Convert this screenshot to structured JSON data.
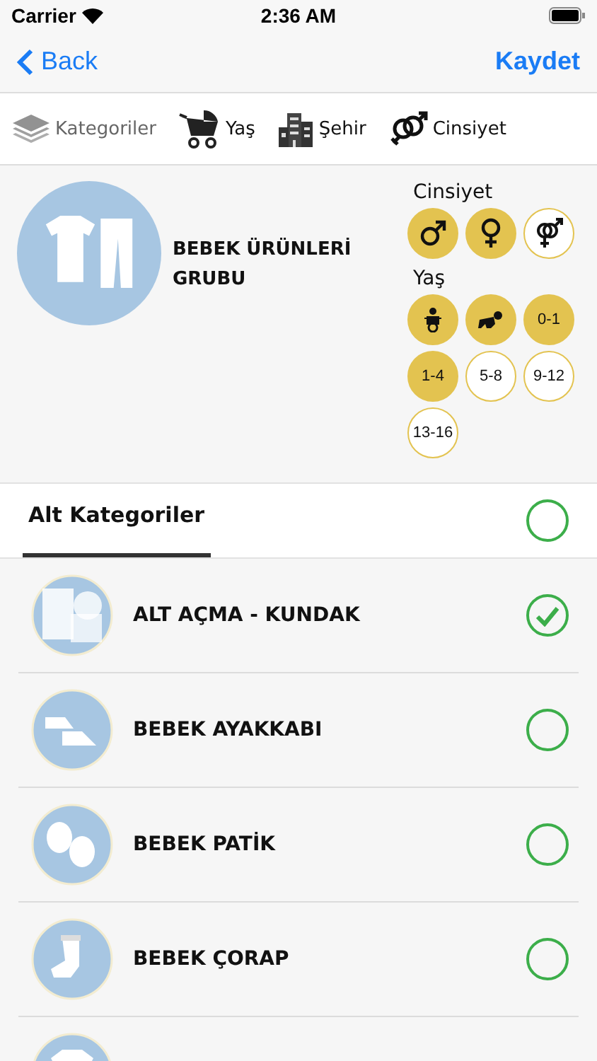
{
  "status_bar": {
    "carrier": "Carrier",
    "time": "2:36 AM"
  },
  "nav": {
    "back": "Back",
    "save": "Kaydet"
  },
  "tabs": [
    {
      "label": "Kategoriler",
      "kind": "layers",
      "selected": true
    },
    {
      "label": "Yaş",
      "kind": "stroller",
      "selected": false
    },
    {
      "label": "Şehir",
      "kind": "city",
      "selected": false
    },
    {
      "label": "Cinsiyet",
      "kind": "gender",
      "selected": false
    }
  ],
  "category": {
    "title": "BEBEK ÜRÜNLERİ GRUBU",
    "gender_label": "Cinsiyet",
    "genders": [
      {
        "kind": "male",
        "selected": true
      },
      {
        "kind": "female",
        "selected": true
      },
      {
        "kind": "both",
        "selected": false
      }
    ],
    "age_label": "Yaş",
    "ages": [
      {
        "kind": "newborn",
        "selected": true
      },
      {
        "kind": "crawling",
        "selected": true
      },
      {
        "kind": "range",
        "label": "0-1",
        "selected": true
      },
      {
        "kind": "range",
        "label": "1-4",
        "selected": true
      },
      {
        "kind": "range",
        "label": "5-8",
        "selected": false
      },
      {
        "kind": "range",
        "label": "9-12",
        "selected": false
      },
      {
        "kind": "range",
        "label": "13-16",
        "selected": false
      }
    ]
  },
  "subcategories_header": {
    "title": "Alt Kategoriler",
    "all_checked": false
  },
  "subcategories": [
    {
      "name": "ALT AÇMA - KUNDAK",
      "kind": "swaddle",
      "checked": true
    },
    {
      "name": "BEBEK AYAKKABI",
      "kind": "shoes",
      "checked": false
    },
    {
      "name": "BEBEK PATİK",
      "kind": "booties",
      "checked": false
    },
    {
      "name": "BEBEK ÇORAP",
      "kind": "sock",
      "checked": false
    },
    {
      "kind": "shirt"
    }
  ]
}
